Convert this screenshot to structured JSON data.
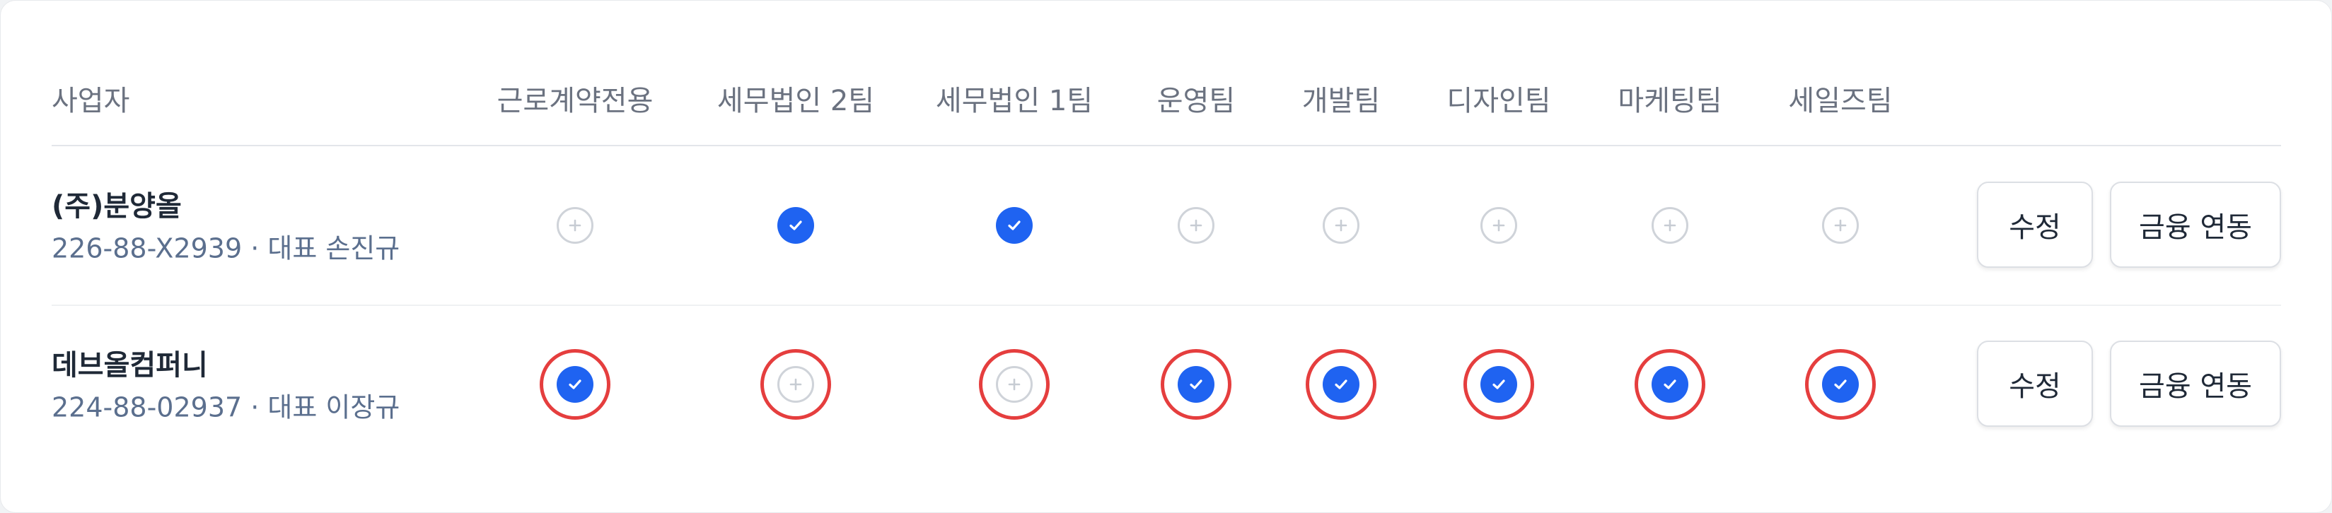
{
  "table": {
    "header": {
      "business": "사업자",
      "groups": [
        "근로계약전용",
        "세무법인 2팀",
        "세무법인 1팀",
        "운영팀",
        "개발팀",
        "디자인팀",
        "마케팅팀",
        "세일즈팀"
      ]
    },
    "rows": [
      {
        "name": "(주)분양올",
        "sub": "226-88-X2939 · 대표 손진규",
        "states": [
          false,
          true,
          true,
          false,
          false,
          false,
          false,
          false
        ],
        "highlighted": [
          false,
          false,
          false,
          false,
          false,
          false,
          false,
          false
        ],
        "edit_label": "수정",
        "finance_label": "금융 연동"
      },
      {
        "name": "데브올컴퍼니",
        "sub": "224-88-02937 · 대표 이장규",
        "states": [
          true,
          false,
          false,
          true,
          true,
          true,
          true,
          true
        ],
        "highlighted": [
          true,
          true,
          true,
          true,
          true,
          true,
          true,
          true
        ],
        "edit_label": "수정",
        "finance_label": "금융 연동"
      }
    ]
  },
  "colors": {
    "checked": "#1f63f1",
    "unchecked_border": "#cfd3d9",
    "highlight_ring": "#e53e3e",
    "sub_text": "#5b6f8e"
  },
  "icons": {
    "checked": "check-icon",
    "unchecked": "plus-icon"
  }
}
